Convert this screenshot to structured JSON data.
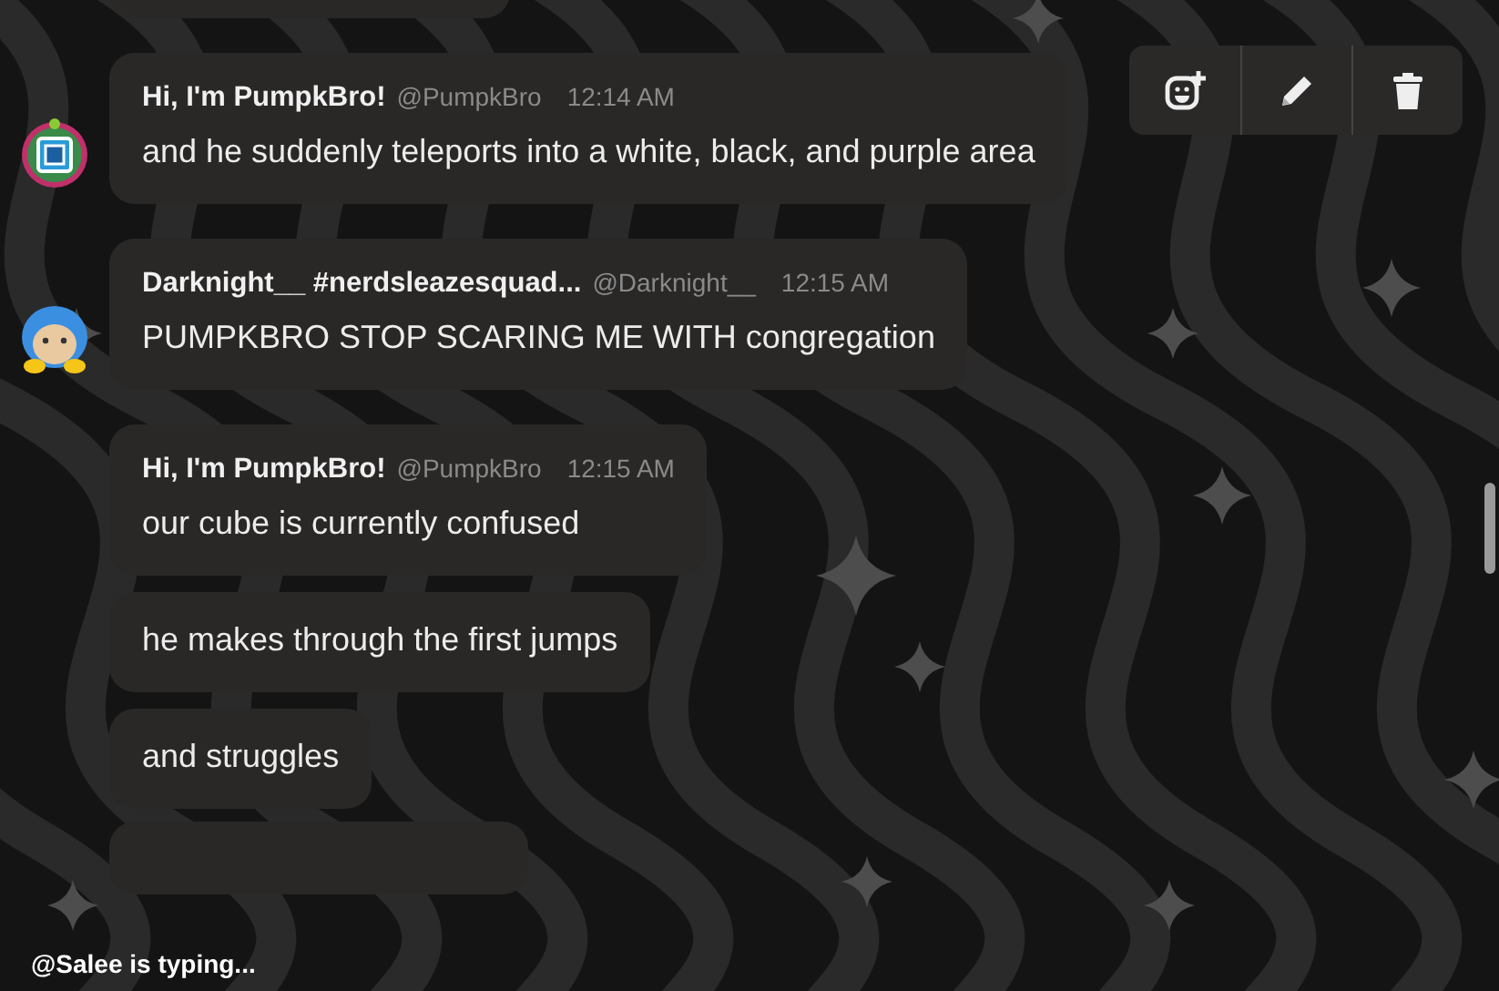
{
  "message_groups": [
    {
      "avatar": {
        "kind": "cube"
      },
      "messages": [
        {
          "author": "Hi, I'm PumpkBro!",
          "handle": "@PumpkBro",
          "time": "12:14 AM",
          "text": "and he suddenly teleports into a white, black, and purple area"
        }
      ]
    },
    {
      "avatar": {
        "kind": "penguin"
      },
      "messages": [
        {
          "author": "Darknight__ #nerdsleazesquad...",
          "handle": "@Darknight__",
          "time": "12:15 AM",
          "text": "PUMPKBRO STOP SCARING ME WITH congregation"
        }
      ]
    },
    {
      "messages": [
        {
          "author": "Hi, I'm PumpkBro!",
          "handle": "@PumpkBro",
          "time": "12:15 AM",
          "text": "our cube is currently confused"
        },
        {
          "text": "he makes through the first jumps"
        },
        {
          "text": "and struggles"
        }
      ]
    }
  ],
  "message_actions": [
    {
      "kind": "add_reaction"
    },
    {
      "kind": "edit"
    },
    {
      "kind": "delete"
    }
  ],
  "typing_indicator": "@Salee is typing..."
}
